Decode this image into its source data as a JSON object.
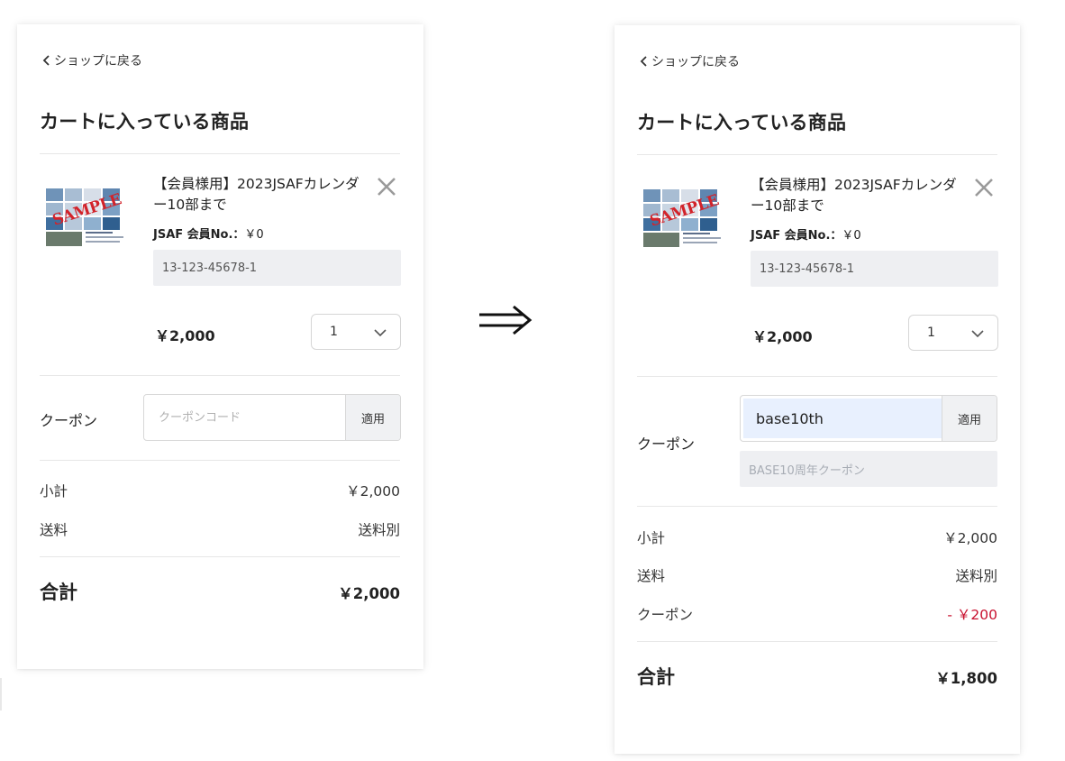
{
  "colors": {
    "discount": "#c8102e",
    "input_bg": "#eeeff2",
    "autofill_bg": "#e8f0fe"
  },
  "before": {
    "back_link": "ショップに戻る",
    "title": "カートに入っている商品",
    "product": {
      "name": "【会員様用】2023JSAFカレンダー10部まで",
      "member_label": "JSAF 会員No.：",
      "member_price": "￥0",
      "member_number": "13-123-45678-1",
      "thumbnail_text": "SAMPLE",
      "price": "￥2,000",
      "quantity": "1"
    },
    "coupon": {
      "label": "クーポン",
      "placeholder": "クーポンコード",
      "value": "",
      "apply_label": "適用"
    },
    "summary": [
      {
        "label": "小計",
        "value": "￥2,000"
      },
      {
        "label": "送料",
        "value": "送料別"
      }
    ],
    "total": {
      "label": "合計",
      "value": "￥2,000"
    }
  },
  "arrow_icon": "double-right-arrow-icon",
  "after": {
    "back_link": "ショップに戻る",
    "title": "カートに入っている商品",
    "product": {
      "name": "【会員様用】2023JSAFカレンダー10部まで",
      "member_label": "JSAF 会員No.：",
      "member_price": "￥0",
      "member_number": "13-123-45678-1",
      "thumbnail_text": "SAMPLE",
      "price": "￥2,000",
      "quantity": "1"
    },
    "coupon": {
      "label": "クーポン",
      "value": "base10th",
      "apply_label": "適用",
      "applied_name": "BASE10周年クーポン"
    },
    "summary": [
      {
        "label": "小計",
        "value": "￥2,000"
      },
      {
        "label": "送料",
        "value": "送料別"
      },
      {
        "label": "クーポン",
        "value": "- ￥200"
      }
    ],
    "total": {
      "label": "合計",
      "value": "￥1,800"
    }
  }
}
